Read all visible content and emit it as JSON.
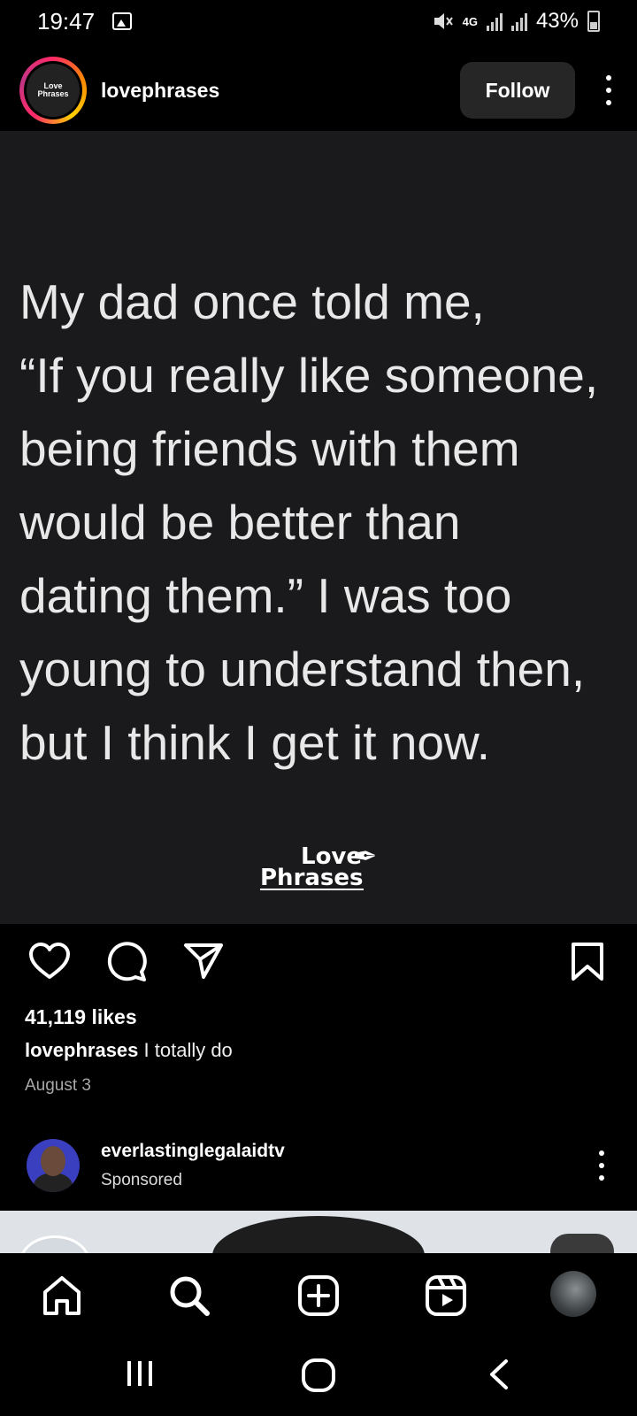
{
  "status_bar": {
    "time": "19:47",
    "network": "4G",
    "battery": "43%"
  },
  "post": {
    "avatar_text_line1": "Love",
    "avatar_text_line2": "Phrases",
    "username": "lovephrases",
    "follow_label": "Follow",
    "image": {
      "quote_lines": [
        "My dad once told me,",
        "“If you really like someone,",
        "being friends with them",
        "would be better than",
        "dating them.” I was too",
        "young to understand then,",
        "but I think I get it now."
      ],
      "brand_line1": "Love",
      "brand_line2": "Phrases"
    },
    "likes": "41,119 likes",
    "caption_user": "lovephrases",
    "caption_text": " I totally do",
    "date": "August 3"
  },
  "sponsored_post": {
    "username": "everlastinglegalaidtv",
    "label": "Sponsored"
  },
  "icons": {
    "like": "heart-icon",
    "comment": "comment-icon",
    "share": "send-icon",
    "save": "bookmark-icon",
    "home": "home-icon",
    "search": "search-icon",
    "create": "add-icon",
    "reels": "reels-icon",
    "profile": "profile-avatar"
  },
  "colors": {
    "background": "#000000",
    "post_bg": "#1a191b",
    "follow_button": "#262626",
    "secondary_text": "#a8a8a8"
  }
}
